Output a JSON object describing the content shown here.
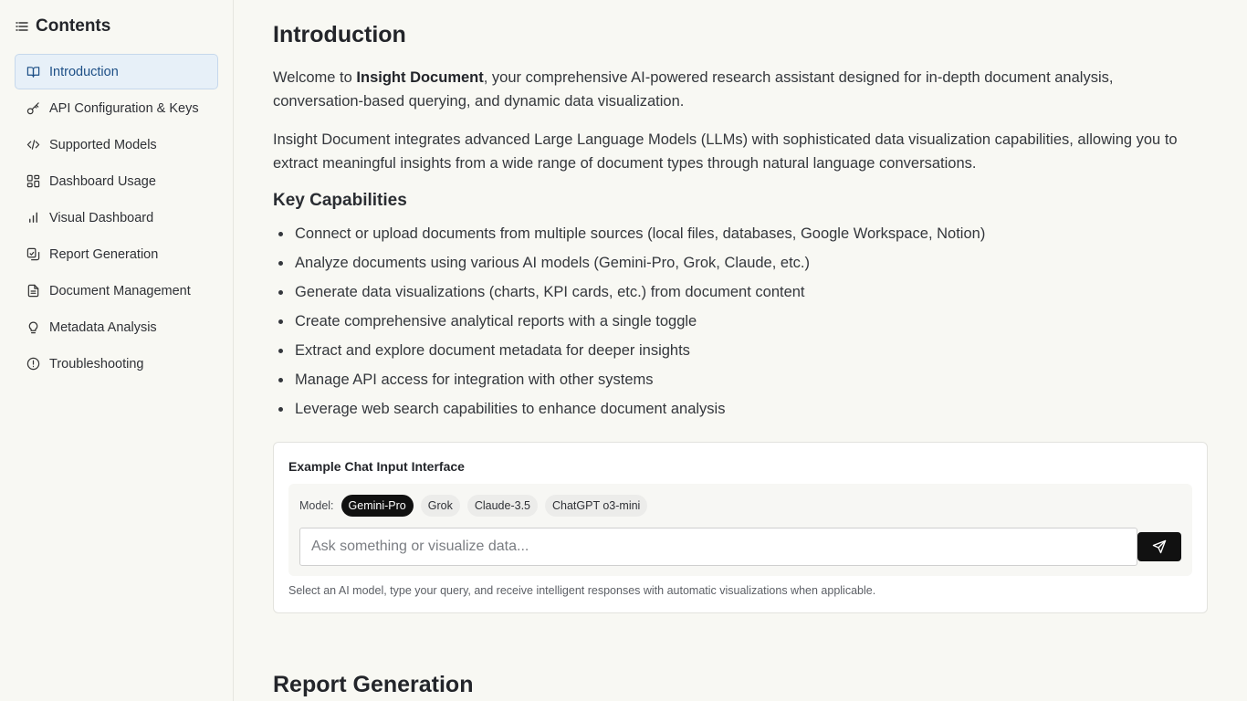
{
  "sidebar": {
    "title": "Contents",
    "header_icon": "list-icon",
    "items": [
      {
        "label": "Introduction",
        "icon": "book-open-icon",
        "active": true
      },
      {
        "label": "API Configuration & Keys",
        "icon": "key-icon"
      },
      {
        "label": "Supported Models",
        "icon": "code-icon"
      },
      {
        "label": "Dashboard Usage",
        "icon": "layout-grid-icon"
      },
      {
        "label": "Visual Dashboard",
        "icon": "bar-chart-icon"
      },
      {
        "label": "Report Generation",
        "icon": "file-stack-icon"
      },
      {
        "label": "Document Management",
        "icon": "file-text-icon"
      },
      {
        "label": "Metadata Analysis",
        "icon": "lightbulb-icon"
      },
      {
        "label": "Troubleshooting",
        "icon": "alert-circle-icon"
      }
    ]
  },
  "main": {
    "title": "Introduction",
    "intro": {
      "prefix": "Welcome to ",
      "brand": "Insight Document",
      "suffix": ", your comprehensive AI-powered research assistant designed for in-depth document analysis, conversation-based querying, and dynamic data visualization."
    },
    "paragraph2": "Insight Document integrates advanced Large Language Models (LLMs) with sophisticated data visualization capabilities, allowing you to extract meaningful insights from a wide range of document types through natural language conversations.",
    "capabilities_title": "Key Capabilities",
    "capabilities": [
      "Connect or upload documents from multiple sources (local files, databases, Google Workspace, Notion)",
      "Analyze documents using various AI models (Gemini-Pro, Grok, Claude, etc.)",
      "Generate data visualizations (charts, KPI cards, etc.) from document content",
      "Create comprehensive analytical reports with a single toggle",
      "Extract and explore document metadata for deeper insights",
      "Manage API access for integration with other systems",
      "Leverage web search capabilities to enhance document analysis"
    ],
    "example": {
      "title": "Example Chat Input Interface",
      "model_label": "Model:",
      "models": [
        "Gemini-Pro",
        "Grok",
        "Claude-3.5",
        "ChatGPT o3-mini"
      ],
      "selected_model": "Gemini-Pro",
      "input_placeholder": "Ask something or visualize data...",
      "input_value": "",
      "send_icon": "send-icon",
      "note": "Select an AI model, type your query, and receive intelligent responses with automatic visualizations when applicable."
    },
    "next_section_title": "Report Generation"
  },
  "colors": {
    "background": "#f8f8f3",
    "active_nav_bg": "#e7f0f8",
    "active_nav_text": "#1d4f86",
    "chip_active_bg": "#111111"
  }
}
